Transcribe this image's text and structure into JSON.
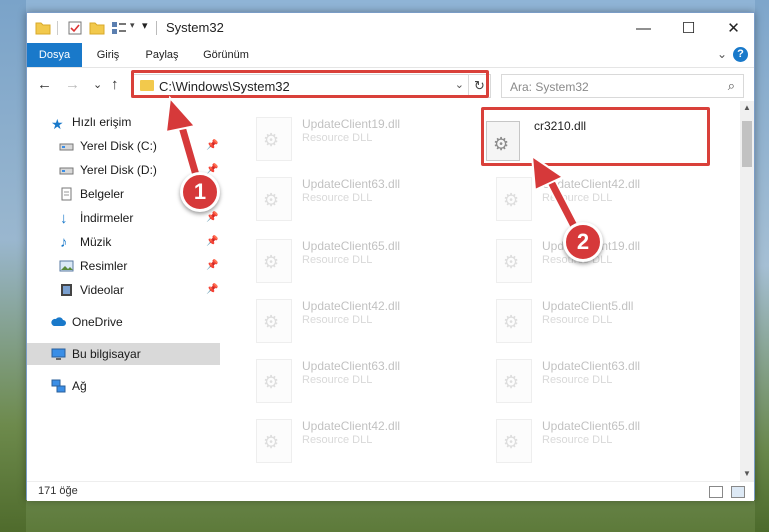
{
  "window": {
    "title": "System32",
    "minimize_label": "—",
    "maximize_label": "☐",
    "close_label": "✕"
  },
  "ribbon": {
    "tabs": [
      "Dosya",
      "Giriş",
      "Paylaş",
      "Görünüm"
    ],
    "expand_glyph": "⌄",
    "help_label": "?"
  },
  "navigation": {
    "back_glyph": "←",
    "forward_glyph": "→",
    "recent_glyph": "⌄",
    "up_glyph": "↑"
  },
  "address": {
    "path": "C:\\Windows\\System32",
    "dropdown_glyph": "⌄",
    "refresh_glyph": "↻"
  },
  "search": {
    "placeholder": "Ara: System32",
    "icon_glyph": "⌕"
  },
  "sidebar": {
    "items": [
      {
        "label": "Hızlı erişim",
        "icon": "star-icon",
        "pinned": false
      },
      {
        "label": "Yerel Disk (C:)",
        "icon": "drive-icon",
        "pinned": true
      },
      {
        "label": "Yerel Disk (D:)",
        "icon": "drive-icon",
        "pinned": true
      },
      {
        "label": "Belgeler",
        "icon": "documents-icon",
        "pinned": true
      },
      {
        "label": "İndirmeler",
        "icon": "download-icon",
        "pinned": true
      },
      {
        "label": "Müzik",
        "icon": "music-icon",
        "pinned": true
      },
      {
        "label": "Resimler",
        "icon": "pictures-icon",
        "pinned": true
      },
      {
        "label": "Videolar",
        "icon": "video-icon",
        "pinned": true
      },
      {
        "label": "OneDrive",
        "icon": "cloud-icon",
        "pinned": false
      },
      {
        "label": "Bu bilgisayar",
        "icon": "computer-icon",
        "pinned": false
      },
      {
        "label": "Ağ",
        "icon": "network-icon",
        "pinned": false
      }
    ],
    "pin_glyph": "📌"
  },
  "files": {
    "highlighted": {
      "name": "cr3210.dll",
      "type": ""
    },
    "faded": [
      {
        "name": "UpdateClient19.dll",
        "type": "Resource DLL"
      },
      {
        "name": "UpdateClient63.dll",
        "type": "Resource DLL"
      },
      {
        "name": "UpdateClient42.dll",
        "type": "Resource DLL"
      },
      {
        "name": "UpdateClient65.dll",
        "type": "Resource DLL"
      },
      {
        "name": "UpdateClient19.dll",
        "type": "Resource DLL"
      },
      {
        "name": "UpdateClient42.dll",
        "type": "Resource DLL"
      },
      {
        "name": "UpdateClient5.dll",
        "type": "Resource DLL"
      },
      {
        "name": "UpdateClient63.dll",
        "type": "Resource DLL"
      },
      {
        "name": "UpdateClient63.dll",
        "type": "Resource DLL"
      },
      {
        "name": "UpdateClient42.dll",
        "type": "Resource DLL"
      },
      {
        "name": "UpdateClient65.dll",
        "type": "Resource DLL"
      }
    ]
  },
  "status": {
    "item_count": "171 öğe"
  },
  "callouts": {
    "one": "1",
    "two": "2"
  },
  "colors": {
    "accent": "#1979ca",
    "highlight_red": "#d9403a",
    "callout_red": "#d6393a"
  }
}
